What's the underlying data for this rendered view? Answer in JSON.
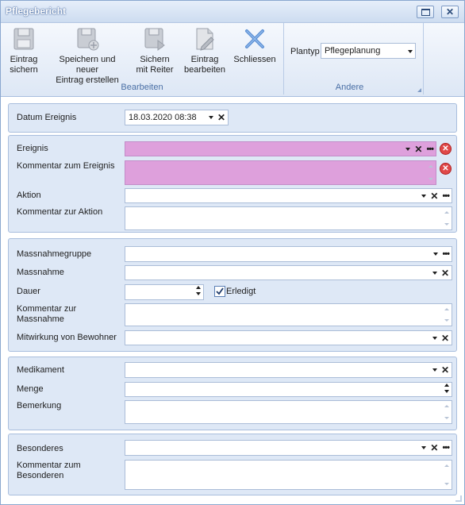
{
  "window": {
    "title": "Pflegebericht"
  },
  "ribbon": {
    "buttons": [
      {
        "label_line1": "Eintrag",
        "label_line2": "sichern"
      },
      {
        "label_line1": "Speichern und neuer",
        "label_line2": "Eintrag erstellen"
      },
      {
        "label_line1": "Sichern",
        "label_line2": "mit Reiter"
      },
      {
        "label_line1": "Eintrag",
        "label_line2": "bearbeiten"
      },
      {
        "label_line1": "Schliessen",
        "label_line2": ""
      }
    ],
    "group_bearbeiten": "Bearbeiten",
    "group_andere": "Andere",
    "plantyp_label": "Plantyp",
    "plantyp_value": "Pflegeplanung"
  },
  "form": {
    "datum_label": "Datum Ereignis",
    "datum_value": "18.03.2020 08:38",
    "ereignis_label": "Ereignis",
    "kommentar_ereignis_label": "Kommentar zum Ereignis",
    "aktion_label": "Aktion",
    "kommentar_aktion_label": "Kommentar zur Aktion",
    "massnahmegruppe_label": "Massnahmegruppe",
    "massnahme_label": "Massnahme",
    "dauer_label": "Dauer",
    "erledigt_label": "Erledigt",
    "erledigt_checked": true,
    "kommentar_massnahme_label_1": "Kommentar zur",
    "kommentar_massnahme_label_2": "Massnahme",
    "mitwirkung_label": "Mitwirkung von Bewohner",
    "medikament_label": "Medikament",
    "menge_label": "Menge",
    "bemerkung_label": "Bemerkung",
    "besonderes_label": "Besonderes",
    "kommentar_besonderen_label_1": "Kommentar zum",
    "kommentar_besonderen_label_2": "Besonderen"
  },
  "colors": {
    "required_field": "#dea0dc",
    "panel": "#dee8f6",
    "accent": "#4a6fa5"
  }
}
